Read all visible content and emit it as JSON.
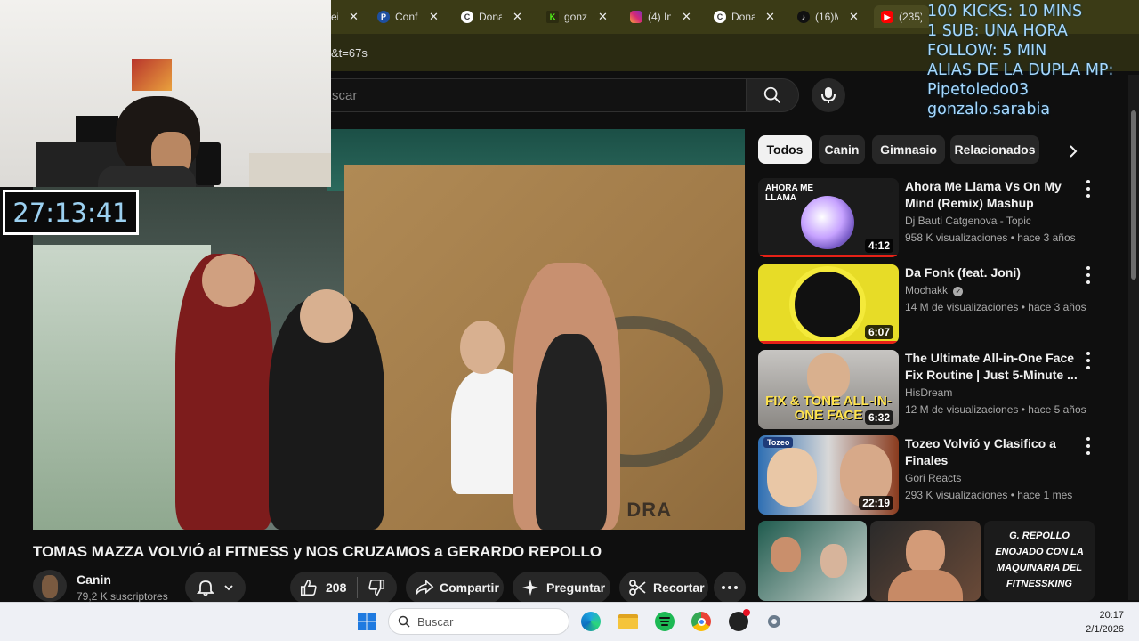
{
  "browser": {
    "tabs": [
      {
        "label": "ei",
        "favicon": "tab-icon"
      },
      {
        "label": "Confi",
        "favicon": "paypal-icon"
      },
      {
        "label": "Dona",
        "favicon": "generic-c-icon"
      },
      {
        "label": "gonz",
        "favicon": "kick-icon"
      },
      {
        "label": "(4) In",
        "favicon": "instagram-icon"
      },
      {
        "label": "Dona",
        "favicon": "generic-c-icon"
      },
      {
        "label": "(16)M",
        "favicon": "tiktok-icon"
      },
      {
        "label": "(235)",
        "favicon": "youtube-icon"
      }
    ],
    "close_glyph": "✕",
    "url": "&t=67s"
  },
  "youtube": {
    "search_placeholder": "scar",
    "chips": [
      "Todos",
      "Canin",
      "Gimnasio",
      "Relacionados"
    ],
    "video_title": "TOMAS MAZZA VOLVIÓ al FITNESS y NOS CRUZAMOS a GERARDO REPOLLO",
    "video_wall_text": "MIA DOS DRA",
    "channel": {
      "name": "Canin",
      "subscribers": "79,2 K suscriptores"
    },
    "actions": {
      "like_count": "208",
      "share": "Compartir",
      "ask": "Preguntar",
      "clip": "Recortar"
    },
    "recommendations": [
      {
        "title": "Ahora Me Llama Vs On My Mind (Remix) Mashup",
        "channel": "Dj Bauti Catgenova - Topic",
        "meta": "958 K visualizaciones • hace 3 años",
        "duration": "4:12",
        "thumb_text": "AHORA ME LLAMA"
      },
      {
        "title": "Da Fonk (feat. Joni)",
        "channel": "Mochakk",
        "meta": "14 M de visualizaciones • hace 3 años",
        "duration": "6:07",
        "thumb_text": ""
      },
      {
        "title": "The Ultimate All-in-One Face Fix Routine | Just 5-Minute ...",
        "channel": "HisDream",
        "meta": "12 M de visualizaciones • hace 5 años",
        "duration": "6:32",
        "thumb_text": "FIX & TONE ALL-IN-ONE FACE"
      },
      {
        "title": "Tozeo Volvió y Clasifico a Finales",
        "channel": "Gori Reacts",
        "meta": "293 K visualizaciones • hace 1 mes",
        "duration": "22:19",
        "thumb_text": "Tozeo"
      }
    ],
    "shorts": [
      {
        "text": ""
      },
      {
        "text": ""
      },
      {
        "text": "G. REPOLLO ENOJADO CON LA MAQUINARIA DEL FITNESSKING"
      }
    ]
  },
  "stream": {
    "timer": "27:13:41",
    "overlay_lines": [
      "100 KICKS: 10 MINS",
      "1 SUB: UNA HORA",
      "FOLLOW: 5 MIN",
      "ALIAS DE LA DUPLA MP:",
      "Pipetoledo03",
      "gonzalo.sarabia"
    ]
  },
  "taskbar": {
    "search_placeholder": "Buscar",
    "time": "20:17",
    "date": "2/1/2026"
  },
  "colors": {
    "tabbar": "#3b3b16",
    "yt_bg": "#0f0f0f",
    "chip_active": "#f1f1f1",
    "overlay_text": "#a6d8ff",
    "timer_text": "#9bd0f0",
    "watched_bar": "#e62117"
  }
}
